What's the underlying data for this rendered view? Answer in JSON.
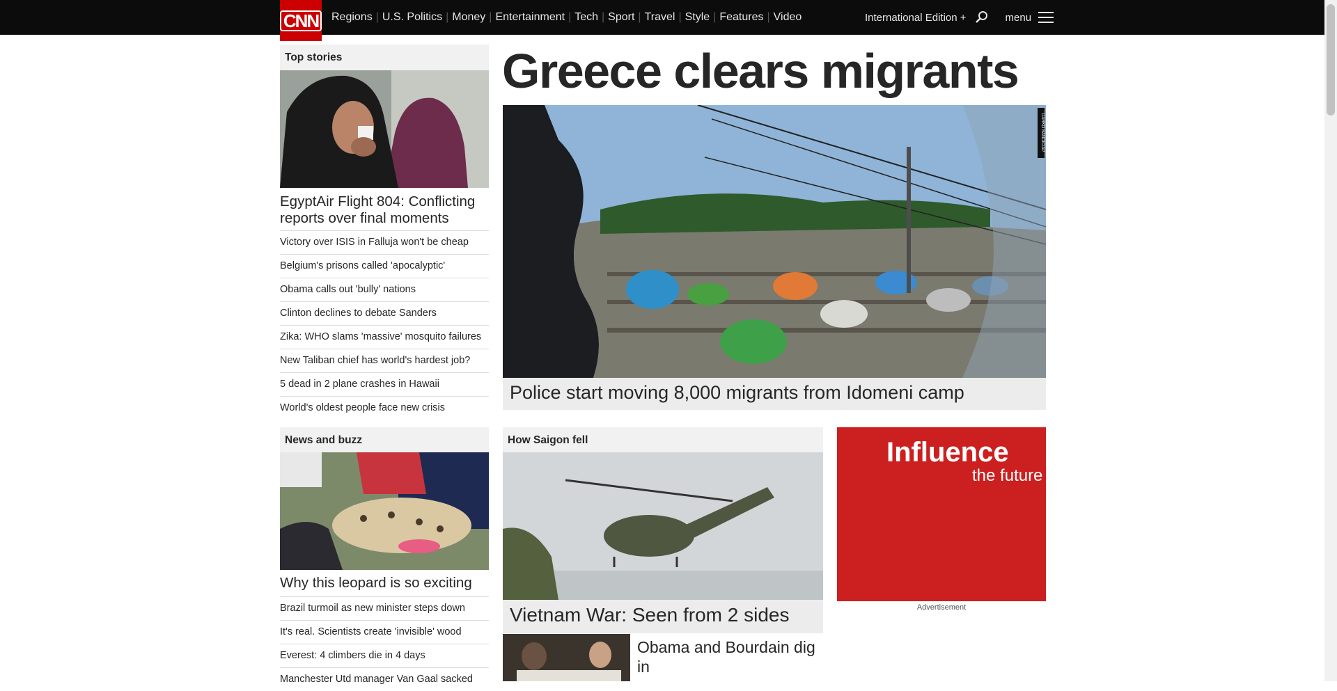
{
  "header": {
    "logo_text": "CNN",
    "nav": [
      "Regions",
      "U.S. Politics",
      "Money",
      "Entertainment",
      "Tech",
      "Sport",
      "Travel",
      "Style",
      "Features",
      "Video"
    ],
    "edition_label": "International Edition +",
    "menu_label": "menu"
  },
  "top_stories": {
    "section_title": "Top stories",
    "lead_headline": "EgyptAir Flight 804: Conflicting reports over final moments",
    "items": [
      "Victory over ISIS in Falluja won't be cheap",
      "Belgium's prisons called 'apocalyptic'",
      "Obama calls out 'bully' nations",
      "Clinton declines to debate Sanders",
      "Zika: WHO slams 'massive' mosquito failures",
      "New Taliban chief has world's hardest job?",
      "5 dead in 2 plane crashes in Hawaii",
      "World's oldest people face new crisis"
    ]
  },
  "main_story": {
    "title": "Greece clears migrants",
    "caption": "Police start moving 8,000 migrants from Idomeni camp",
    "photo_credit": "DARKO BANDIC/AP"
  },
  "news_buzz": {
    "section_title": "News and buzz",
    "lead_headline": "Why this leopard is so exciting",
    "items": [
      "Brazil turmoil as new minister steps down",
      "It's real. Scientists create 'invisible' wood",
      "Everest: 4 climbers die in 4 days",
      "Manchester Utd manager Van Gaal sacked"
    ]
  },
  "saigon": {
    "section_title": "How Saigon fell",
    "caption": "Vietnam War: Seen from 2 sides",
    "secondary_headline": "Obama and Bourdain dig in"
  },
  "ad": {
    "title": "Influence",
    "subtitle": "the future",
    "label": "Advertisement"
  },
  "colors": {
    "brand_red": "#cc0000",
    "topbar": "#0c0c0c",
    "ad_red": "#cc1f1f"
  }
}
